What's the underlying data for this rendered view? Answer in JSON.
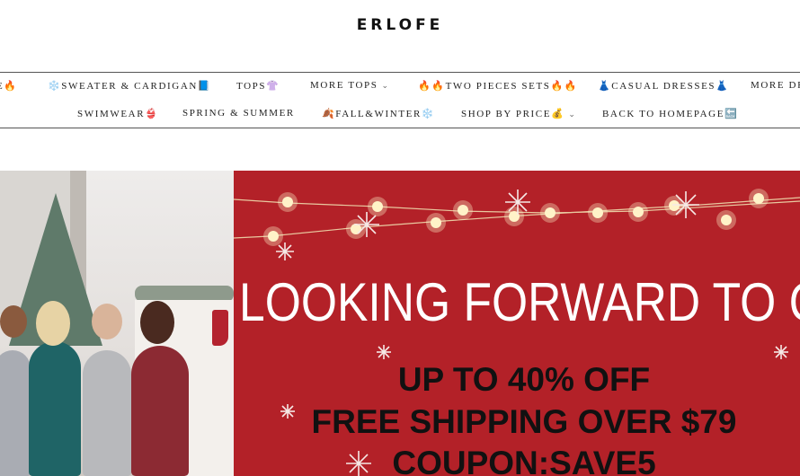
{
  "brand": {
    "logo": "ERLOFE"
  },
  "nav": {
    "row1": [
      {
        "label": "E🔥",
        "dropdown": false
      },
      {
        "label": "❄️SWEATER & CARDIGAN📘",
        "dropdown": false
      },
      {
        "label": "TOPS👚",
        "dropdown": false
      },
      {
        "label": "MORE TOPS",
        "dropdown": true
      },
      {
        "label": "🔥🔥TWO PIECES SETS🔥🔥",
        "dropdown": false
      },
      {
        "label": "👗CASUAL DRESSES👗",
        "dropdown": false
      },
      {
        "label": "MORE DR",
        "dropdown": false
      }
    ],
    "row2": [
      {
        "label": "SWIMWEAR👙",
        "dropdown": false
      },
      {
        "label": "SPRING & SUMMER",
        "dropdown": false
      },
      {
        "label": "🍂FALL&WINTER❄️",
        "dropdown": false
      },
      {
        "label": "SHOP BY PRICE💰",
        "dropdown": true
      },
      {
        "label": "BACK TO HOMEPAGE🔙",
        "dropdown": false
      }
    ]
  },
  "hero": {
    "headline": "LOOKING FORWARD TO CHRIST",
    "offer_line1": "UP TO 40% OFF",
    "offer_line2": "FREE SHIPPING OVER $79",
    "offer_line3": "COUPON:SAVE5",
    "colors": {
      "banner": "#b32128",
      "headline": "#ffffff",
      "offer": "#111111",
      "lights": "#fff2b0"
    }
  }
}
